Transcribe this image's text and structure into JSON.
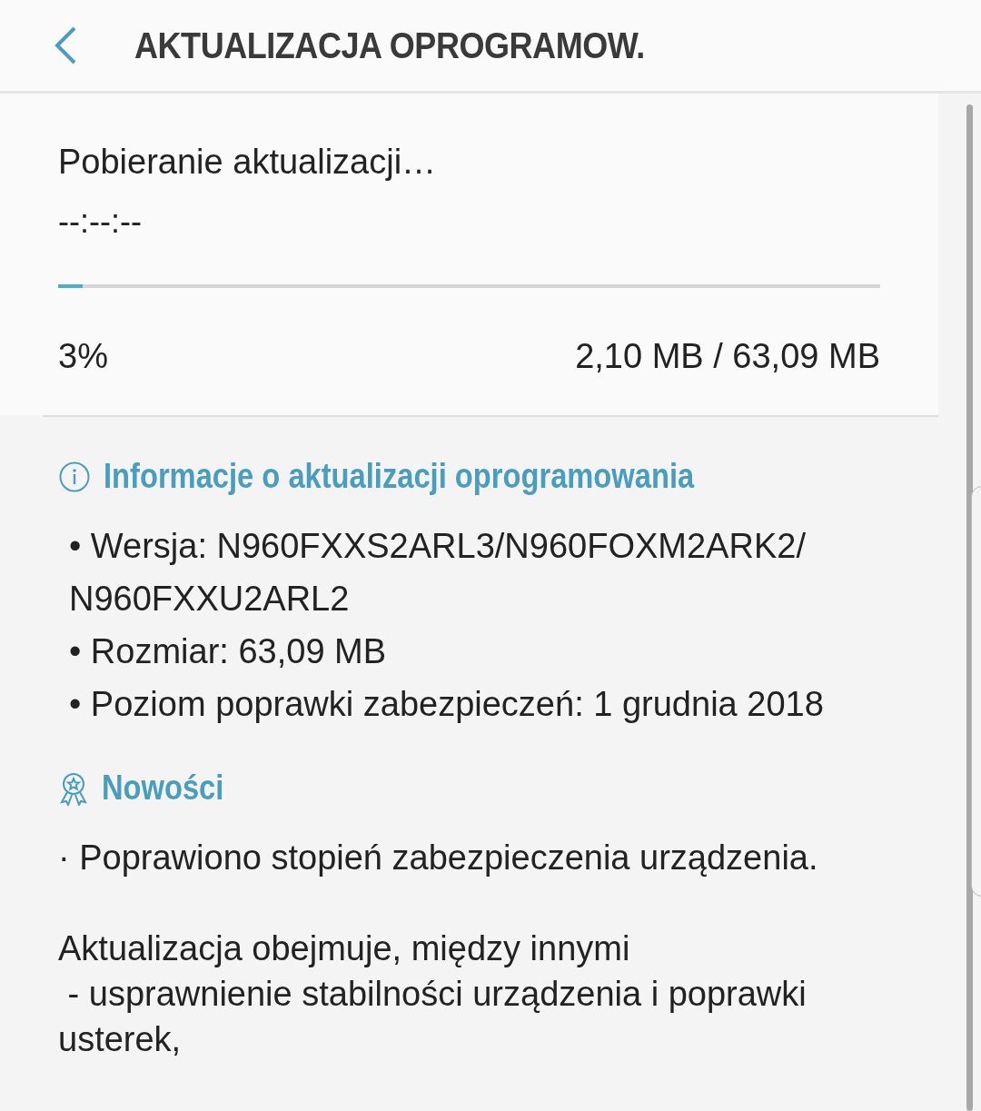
{
  "header": {
    "title": "AKTUALIZACJA OPROGRAMOW."
  },
  "download": {
    "status": "Pobieranie aktualizacji…",
    "time": "--:--:--",
    "level": 0.03,
    "percent": "3%",
    "size": "2,10 MB / 63,09 MB"
  },
  "info": {
    "heading": "Informacje o aktualizacji oprogramowania",
    "items": [
      "• Wersja: N960FXXS2ARL3/N960FOXM2ARK2/ N960FXXU2ARL2",
      "• Rozmiar: 63,09 MB",
      "• Poziom poprawki zabezpieczeń: 1 grudnia 2018"
    ]
  },
  "news": {
    "heading": "Nowości",
    "paragraphs": [
      "· Poprawiono stopień zabezpieczenia urządzenia.",
      "Aktualizacja obejmuje, między innymi\n - usprawnienie stabilności urządzenia i poprawki usterek,"
    ]
  }
}
